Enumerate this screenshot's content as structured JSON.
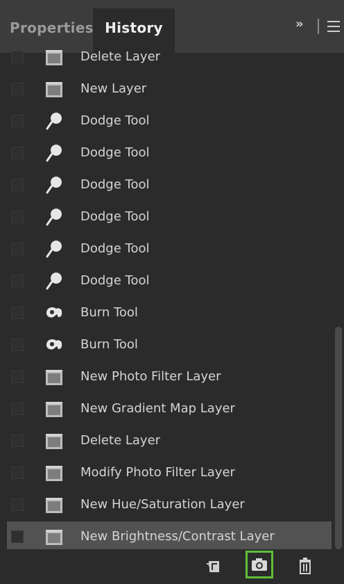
{
  "tabs": {
    "properties": "Properties",
    "history": "History",
    "expand": "»"
  },
  "history": {
    "items": [
      {
        "label": "Delete Layer",
        "icon": "layer-icon"
      },
      {
        "label": "New Layer",
        "icon": "layer-icon"
      },
      {
        "label": "Dodge Tool",
        "icon": "dodge-icon"
      },
      {
        "label": "Dodge Tool",
        "icon": "dodge-icon"
      },
      {
        "label": "Dodge Tool",
        "icon": "dodge-icon"
      },
      {
        "label": "Dodge Tool",
        "icon": "dodge-icon"
      },
      {
        "label": "Dodge Tool",
        "icon": "dodge-icon"
      },
      {
        "label": "Dodge Tool",
        "icon": "dodge-icon"
      },
      {
        "label": "Burn Tool",
        "icon": "burn-icon"
      },
      {
        "label": "Burn Tool",
        "icon": "burn-icon"
      },
      {
        "label": "New Photo Filter Layer",
        "icon": "layer-icon"
      },
      {
        "label": "New Gradient Map Layer",
        "icon": "layer-icon"
      },
      {
        "label": "Delete Layer",
        "icon": "layer-icon"
      },
      {
        "label": "Modify Photo Filter Layer",
        "icon": "layer-icon"
      },
      {
        "label": "New Hue/Saturation Layer",
        "icon": "layer-icon"
      },
      {
        "label": "New Brightness/Contrast Layer",
        "icon": "layer-icon",
        "selected": true
      }
    ]
  },
  "footer": {
    "buttons": [
      "new-document-from-state-icon",
      "snapshot-camera-icon",
      "trash-icon"
    ]
  },
  "colors": {
    "panel": "#2b2b2b",
    "tabbar": "#3c3c3c",
    "selected_row": "#525252",
    "highlight": "#5fbf3a"
  }
}
